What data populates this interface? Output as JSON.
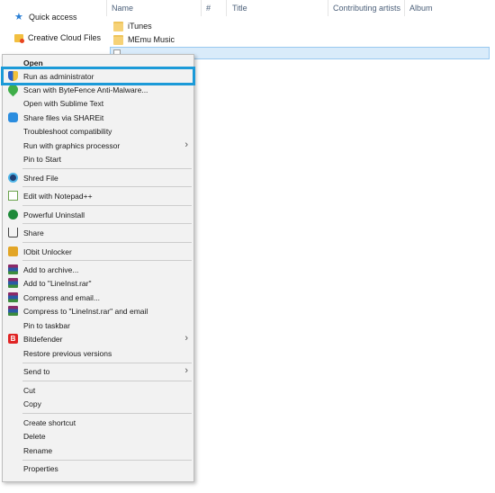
{
  "nav": {
    "quick_access": "Quick access",
    "creative_cloud": "Creative Cloud Files"
  },
  "columns": {
    "name": "Name",
    "number": "#",
    "title": "Title",
    "contributing_artists": "Contributing artists",
    "album": "Album"
  },
  "files": [
    "iTunes",
    "MEmu Music"
  ],
  "menu": {
    "open": "Open",
    "run_as_admin": "Run as administrator",
    "scan_bytefence": "Scan with ByteFence Anti-Malware...",
    "open_sublime": "Open with Sublime Text",
    "shareit": "Share files via SHAREit",
    "troubleshoot": "Troubleshoot compatibility",
    "run_graphics": "Run with graphics processor",
    "pin_start": "Pin to Start",
    "shred": "Shred File",
    "edit_npp": "Edit with Notepad++",
    "powerful_uninstall": "Powerful Uninstall",
    "share": "Share",
    "iobit": "IObit Unlocker",
    "add_archive": "Add to archive...",
    "add_rar": "Add to \"LineInst.rar\"",
    "compress_email": "Compress and email...",
    "compress_rar_email": "Compress to \"LineInst.rar\" and email",
    "pin_taskbar": "Pin to taskbar",
    "bitdefender": "Bitdefender",
    "restore_versions": "Restore previous versions",
    "send_to": "Send to",
    "cut": "Cut",
    "copy": "Copy",
    "create_shortcut": "Create shortcut",
    "delete": "Delete",
    "rename": "Rename",
    "properties": "Properties"
  },
  "icons": {
    "bitdefender_letter": "B",
    "submenu_arrow": "›"
  },
  "colors": {
    "highlight_border": "#1b9ad8",
    "selection_bg": "#d9ebfa",
    "menu_bg": "#f2f2f2"
  }
}
